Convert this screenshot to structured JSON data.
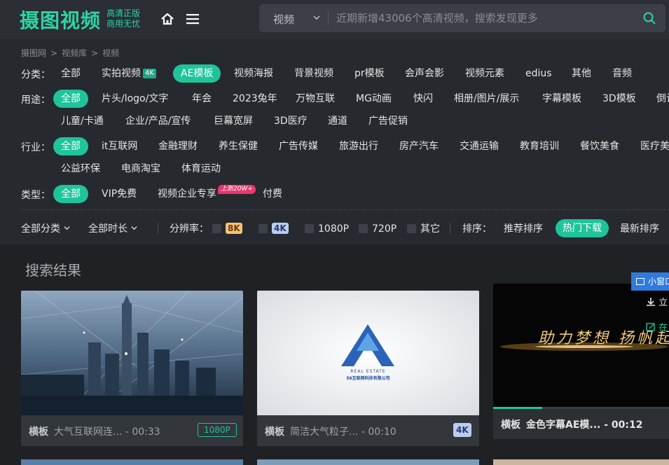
{
  "header": {
    "logo": "摄图视频",
    "logo_sub_1": "高清正版",
    "logo_sub_2": "商用无忧",
    "search_type": "视频",
    "search_placeholder": "近期新增43006个高清视频，搜索发现更多"
  },
  "breadcrumb": [
    "摄图网",
    "视频库",
    "视频"
  ],
  "filters": {
    "category": {
      "label": "分类：",
      "options": [
        "全部",
        "实拍视频",
        "AE模板",
        "视频海报",
        "背景视频",
        "pr模板",
        "会声会影",
        "视频元素",
        "edius",
        "其他",
        "音频"
      ],
      "badge_4k": "4K",
      "active": "AE模板"
    },
    "usage": {
      "label": "用途：",
      "options": [
        "全部",
        "片头/logo/文字",
        "年会",
        "2023兔年",
        "万物互联",
        "MG动画",
        "快闪",
        "相册/图片/展示",
        "字幕模板",
        "3D模板",
        "倒计",
        "儿童/卡通",
        "企业/产品/宣传",
        "巨幕宽屏",
        "3D医疗",
        "通道",
        "广告促销"
      ],
      "active": "全部"
    },
    "industry": {
      "label": "行业：",
      "options": [
        "全部",
        "it互联网",
        "金融理财",
        "养生保健",
        "广告传媒",
        "旅游出行",
        "房产汽车",
        "交通运输",
        "教育培训",
        "餐饮美食",
        "医疗美",
        "公益环保",
        "电商淘宝",
        "体育运动"
      ],
      "active": "全部"
    },
    "type": {
      "label": "类型：",
      "options": [
        "全部",
        "VIP免费",
        "视频企业专享",
        "付费"
      ],
      "new_badge": "上新20W+",
      "active": "全部"
    }
  },
  "sortbar": {
    "all_category": "全部分类",
    "all_duration": "全部时长",
    "resolution_label": "分辨率：",
    "res_8k": "8K",
    "res_4k": "4K",
    "res_1080p": "1080P",
    "res_720p": "720P",
    "res_other": "其它",
    "sort_label": "排序：",
    "sort_recommend": "推荐排序",
    "sort_hot": "热门下载",
    "sort_new": "最新排序"
  },
  "results": {
    "title": "搜索结果",
    "cards": [
      {
        "tag": "横板",
        "title": "大气互联网连...",
        "duration": "- 00:33",
        "res": "1080P"
      },
      {
        "tag": "横板",
        "title": "简洁大气粒子...",
        "duration": "- 00:10",
        "res": "4K",
        "logo_line1": "REAL ESTATE",
        "logo_line2": "56互联网科技有限公司"
      },
      {
        "tag": "横板",
        "title": "金色字幕AE模...",
        "duration": "- 00:12",
        "overlay_text": "助力梦想 扬帆起航",
        "progress": 0.28
      }
    ],
    "mini_window": "小窗口",
    "side_download": "立",
    "side_in": "在"
  },
  "colors": {
    "accent": "#1fc49a",
    "brand": "#2fd3a8",
    "badge_new": "#e8376d",
    "mini_btn": "#2e7bdc"
  }
}
